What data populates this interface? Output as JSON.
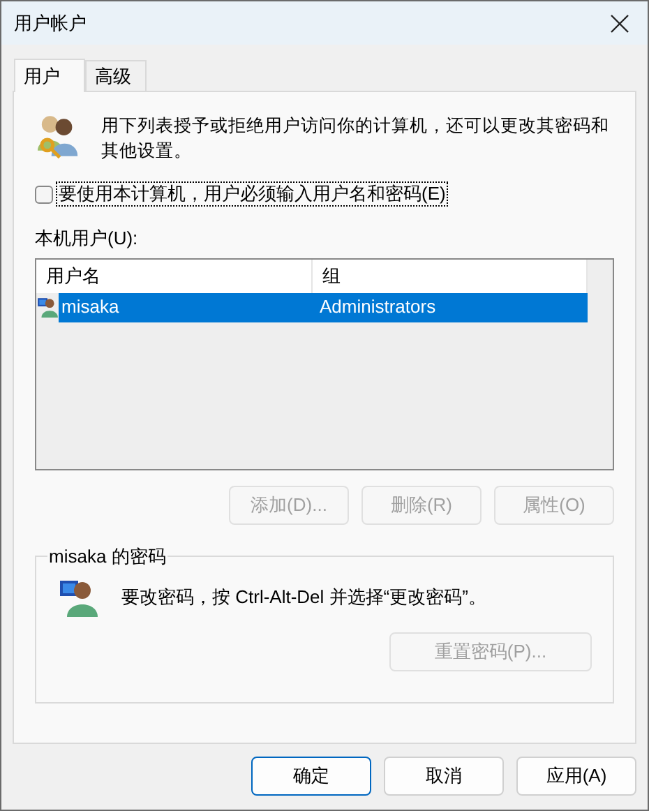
{
  "window": {
    "title": "用户帐户"
  },
  "tabs": [
    {
      "label": "用户",
      "selected": true
    },
    {
      "label": "高级",
      "selected": false
    }
  ],
  "intro": "用下列表授予或拒绝用户访问你的计算机，还可以更改其密码和其他设置。",
  "require_login": {
    "label": "要使用本计算机，用户必须输入用户名和密码(E)",
    "checked": false
  },
  "users_label": "本机用户(U):",
  "table": {
    "columns": [
      "用户名",
      "组"
    ],
    "rows": [
      {
        "cells": [
          "misaka",
          "Administrators"
        ],
        "selected": true
      }
    ]
  },
  "user_buttons": [
    {
      "label": "添加(D)...",
      "disabled": true
    },
    {
      "label": "删除(R)",
      "disabled": true
    },
    {
      "label": "属性(O)",
      "disabled": true
    }
  ],
  "password_group": {
    "title": "misaka 的密码",
    "text": "要改密码，按 Ctrl-Alt-Del 并选择“更改密码”。",
    "reset_button": {
      "label": "重置密码(P)...",
      "disabled": true
    }
  },
  "dialog_buttons": [
    {
      "label": "确定",
      "default": true
    },
    {
      "label": "取消",
      "default": false
    },
    {
      "label": "应用(A)",
      "default": false
    }
  ]
}
